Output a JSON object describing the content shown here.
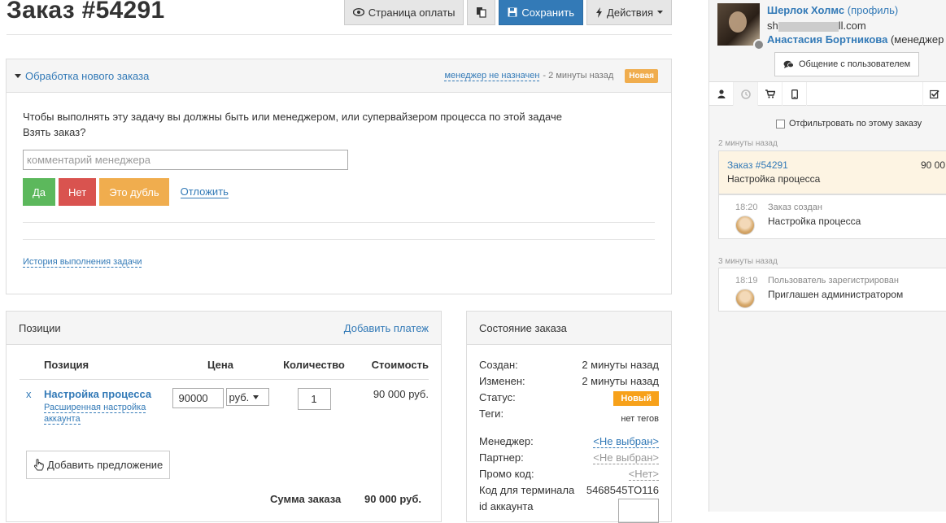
{
  "page": {
    "title": "Заказ #54291"
  },
  "toolbar": {
    "payment_page": "Страница оплаты",
    "save": "Сохранить",
    "actions": "Действия"
  },
  "task": {
    "title": "Обработка нового заказа",
    "manager": "менеджер не назначен",
    "time": "- 2 минуты назад",
    "badge": "Новая",
    "text1": "Чтобы выполнять эту задачу вы должны быть или менеджером, или супервайзером процесса по этой задаче",
    "text2": "Взять заказ?",
    "comment_placeholder": "комментарий менеджера",
    "yes": "Да",
    "no": "Нет",
    "duplicate": "Это дубль",
    "postpone": "Отложить",
    "history": "История выполнения задачи"
  },
  "items": {
    "title": "Позиции",
    "add_payment": "Добавить платеж",
    "columns": [
      "Позиция",
      "Цена",
      "Количество",
      "Стоимость"
    ],
    "rows": [
      {
        "remove": "x",
        "name": "Настройка процесса",
        "sub": "Расширенная настройка аккаунта",
        "price": "90000",
        "currency": "руб.",
        "qty": "1",
        "cost": "90 000 руб."
      }
    ],
    "add_offer": "Добавить предложение",
    "total_label": "Сумма заказа",
    "total_value": "90 000 руб."
  },
  "state": {
    "title": "Состояние заказа",
    "created_label": "Создан:",
    "created_value": "2 минуты назад",
    "changed_label": "Изменен:",
    "changed_value": "2 минуты назад",
    "status_label": "Статус:",
    "status_value": "Новый",
    "tags_label": "Теги:",
    "tags_value": "нет тегов",
    "manager_label": "Менеджер:",
    "manager_value": "<Не выбран>",
    "partner_label": "Партнер:",
    "partner_value": "<Не выбран>",
    "promo_label": "Промо код:",
    "promo_value": "<Нет>",
    "terminal_label": "Код для терминала",
    "terminal_value": "5468545TO116",
    "account_label": "id аккаунта"
  },
  "sidebar": {
    "user_name": "Шерлок Холмс",
    "profile_link": "(профиль)",
    "email_prefix": "sh",
    "email_suffix": "ll.com",
    "owner_name": "Анастасия Бортникова",
    "owner_role": "(менеджер",
    "chat_button": "Общение с пользователем",
    "filter_label": "Отфильтровать по этому заказу",
    "groups": [
      {
        "label": "2 минуты назад"
      },
      {
        "label": "3 минуты назад"
      }
    ],
    "order_card": {
      "title": "Заказ #54291",
      "amount": "90 00",
      "text": "Настройка процесса"
    },
    "events": [
      {
        "time": "18:20",
        "head": "Заказ создан",
        "text": "Настройка процесса"
      },
      {
        "time": "18:19",
        "head": "Пользователь зарегистрирован",
        "text": "Приглашен администратором"
      }
    ]
  },
  "colors": {
    "primary": "#337ab7",
    "success": "#5cb85c",
    "danger": "#d9534f",
    "warning": "#f0ad4e",
    "status_orange": "#f7a11a"
  }
}
